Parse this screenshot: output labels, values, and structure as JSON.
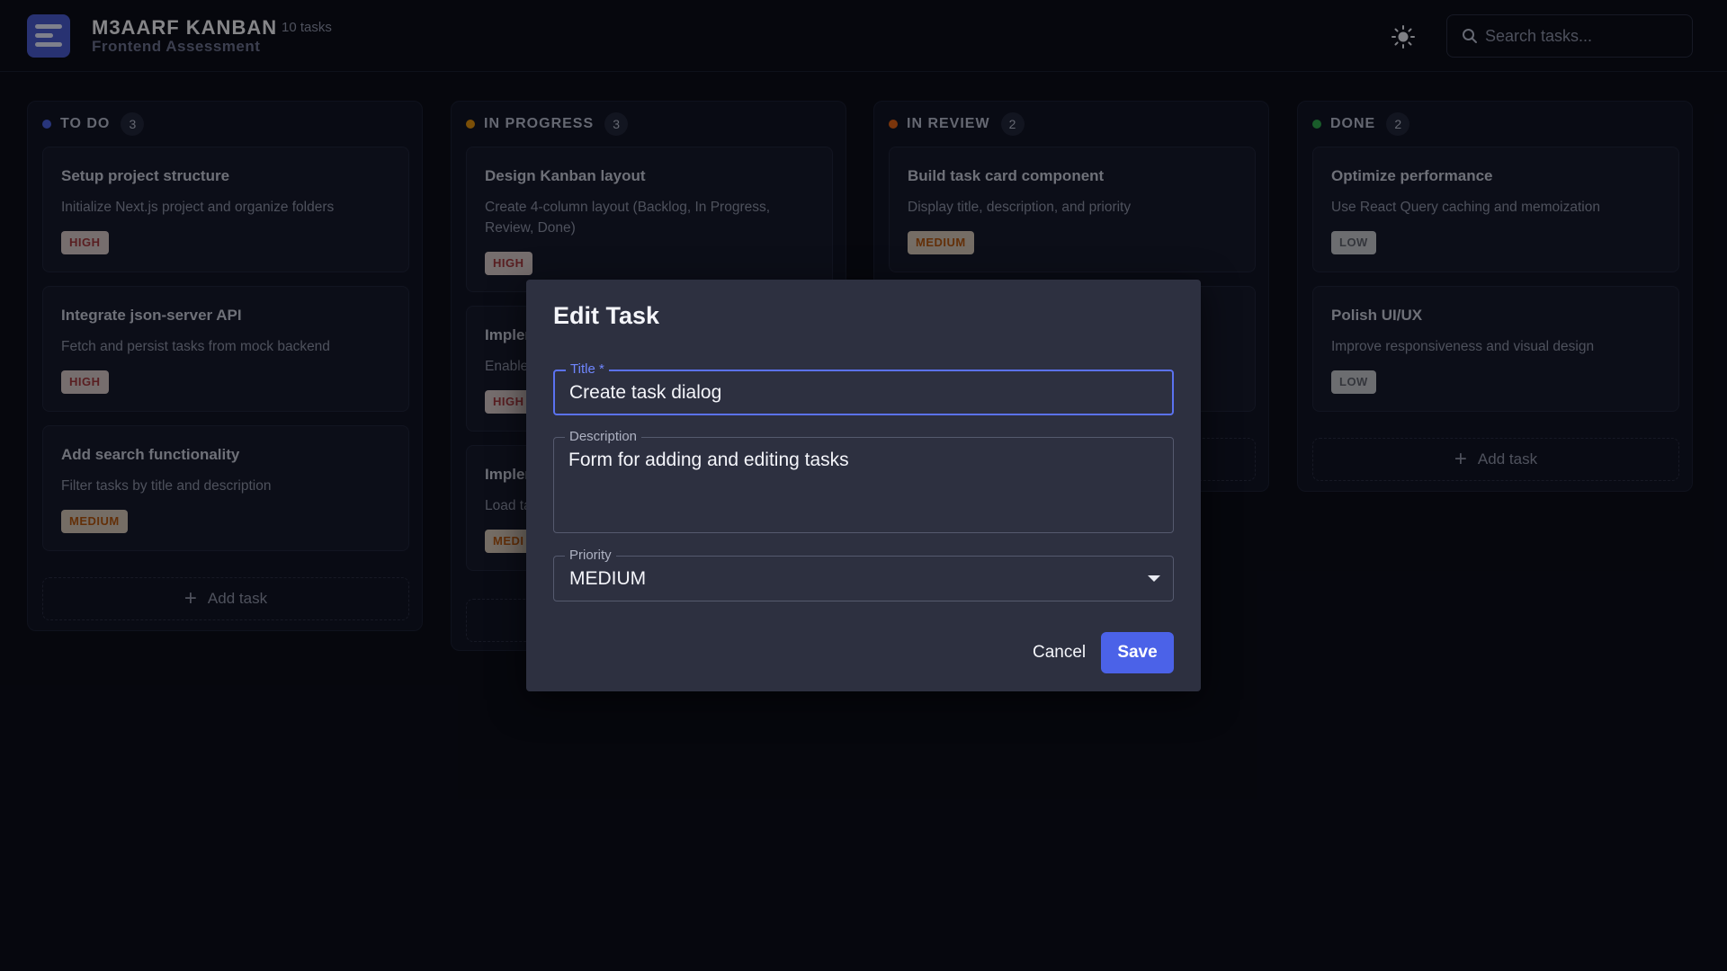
{
  "header": {
    "app_title": "M3AARF KANBAN",
    "task_count": "10 tasks",
    "subtitle": "Frontend Assessment",
    "search_placeholder": "Search tasks..."
  },
  "columns": [
    {
      "name": "TO DO",
      "count": "3",
      "dot_color": "#4a62e0",
      "add_label": "Add task",
      "cards": [
        {
          "title": "Setup project structure",
          "description": "Initialize Next.js project and organize folders",
          "priority": "HIGH"
        },
        {
          "title": "Integrate json-server API",
          "description": "Fetch and persist tasks from mock backend",
          "priority": "HIGH"
        },
        {
          "title": "Add search functionality",
          "description": "Filter tasks by title and description",
          "priority": "MEDIUM"
        }
      ]
    },
    {
      "name": "IN PROGRESS",
      "count": "3",
      "dot_color": "#e0900d",
      "cards": [
        {
          "title": "Design Kanban layout",
          "description": "Create 4-column layout (Backlog, In Progress, Review, Done)",
          "priority": "HIGH"
        },
        {
          "title": "Implem",
          "description": "Enable",
          "priority": "HIGH"
        },
        {
          "title": "Implem",
          "description": "Load ta",
          "priority": "MEDI"
        }
      ]
    },
    {
      "name": "IN REVIEW",
      "count": "2",
      "dot_color": "#e06214",
      "cards": [
        {
          "title": "Build task card component",
          "description": "Display title, description, and priority",
          "priority": "MEDIUM"
        }
      ]
    },
    {
      "name": "DONE",
      "count": "2",
      "dot_color": "#2fa84e",
      "add_label": "Add task",
      "cards": [
        {
          "title": "Optimize performance",
          "description": "Use React Query caching and memoization",
          "priority": "LOW"
        },
        {
          "title": "Polish UI/UX",
          "description": "Improve responsiveness and visual design",
          "priority": "LOW"
        }
      ]
    }
  ],
  "dialog": {
    "title": "Edit Task",
    "title_label": "Title *",
    "title_value": "Create task dialog",
    "description_label": "Description",
    "description_value": "Form for adding and editing tasks",
    "priority_label": "Priority",
    "priority_value": "MEDIUM",
    "cancel_label": "Cancel",
    "save_label": "Save"
  },
  "colors": {
    "accent": "#4b62e8",
    "background": "#0b0d19",
    "dialog_background": "#2d3040"
  },
  "icons": {
    "logo": "kanban-logo-icon",
    "theme_toggle": "sun-icon",
    "search": "search-icon",
    "add": "plus-icon",
    "dropdown": "chevron-down-icon"
  }
}
